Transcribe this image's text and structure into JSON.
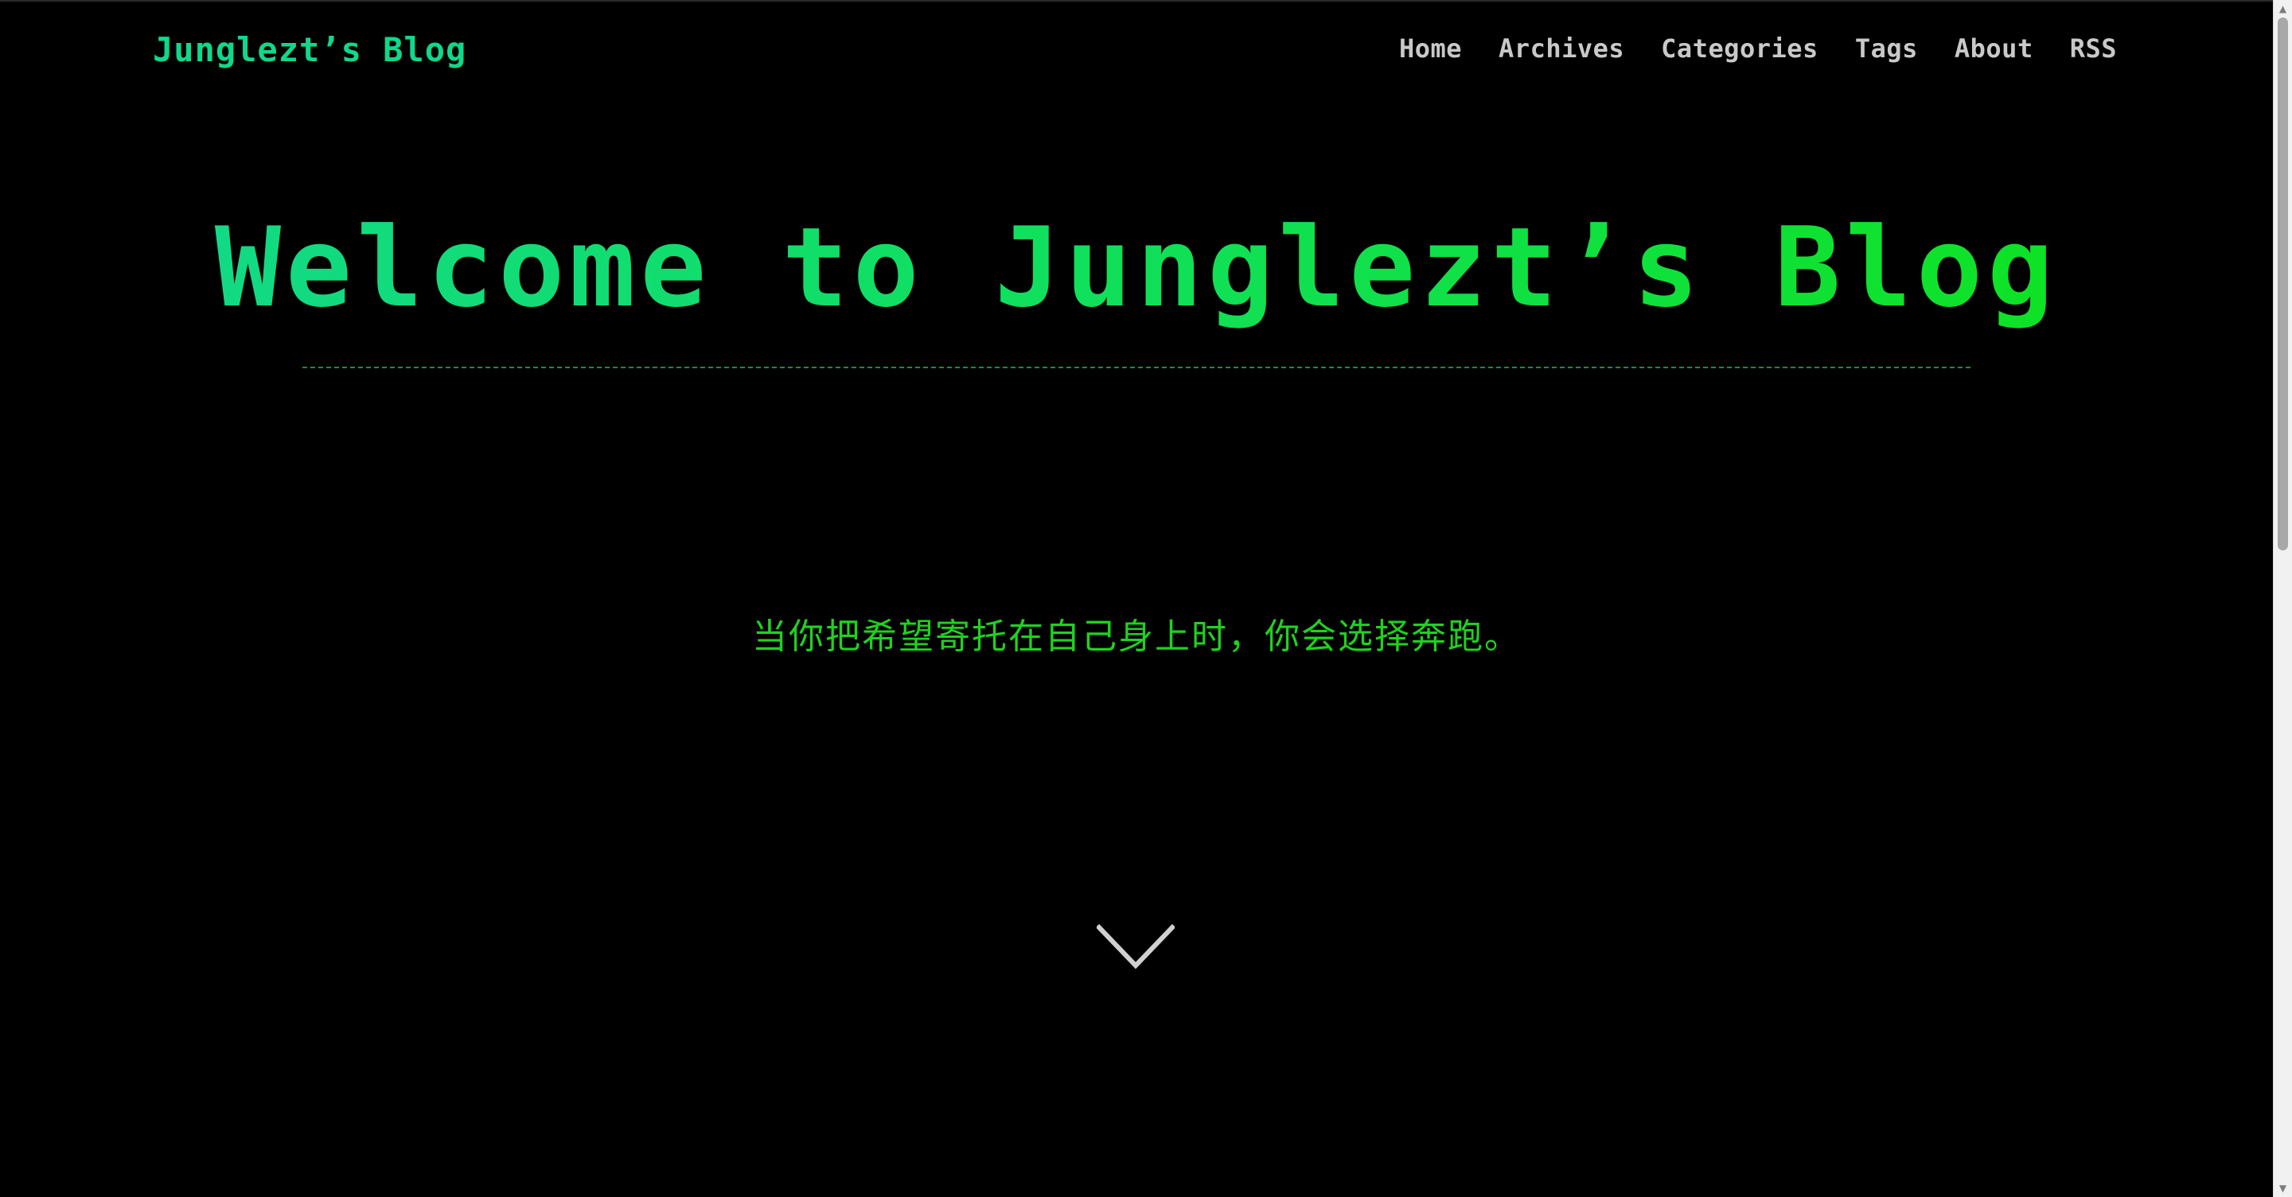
{
  "header": {
    "site_title": "Junglezt’s Blog",
    "nav": [
      {
        "label": "Home"
      },
      {
        "label": "Archives"
      },
      {
        "label": "Categories"
      },
      {
        "label": "Tags"
      },
      {
        "label": "About"
      },
      {
        "label": "RSS"
      }
    ]
  },
  "hero": {
    "title": "Welcome to Junglezt’s Blog",
    "motto": "当你把希望寄托在自己身上时，你会选择奔跑。",
    "scroll_icon": "chevron-down-icon"
  },
  "scrollbar": {
    "up_arrow": "▲",
    "down_arrow": "▼"
  },
  "colors": {
    "background": "#000000",
    "title_start": "#12d88e",
    "title_end": "#0ee21a",
    "motto": "#1fd21f",
    "nav_text": "#c9c9c9",
    "site_title": "#0fd88a"
  }
}
